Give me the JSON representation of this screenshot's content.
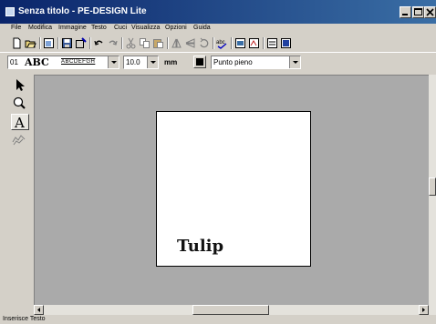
{
  "window": {
    "title": "Senza titolo - PE-DESIGN Lite"
  },
  "menubar": {
    "items": [
      "File",
      "Modifica",
      "Immagine",
      "Testo",
      "Cuci",
      "Visualizza",
      "Opzioni",
      "Guida"
    ]
  },
  "text_toolbar": {
    "font_number": "01",
    "font_sample": "ABC",
    "font_style": "ABCDEFGH",
    "size_value": "10.0",
    "size_unit": "mm",
    "sew_type": "Punto pieno",
    "thread_color": "#000000"
  },
  "canvas": {
    "text": "Tulip"
  },
  "status": {
    "text": "Inserisce Testo"
  },
  "colors": {
    "title_start": "#0a246a",
    "title_end": "#3a6ea5",
    "chrome": "#d4d0c8",
    "workspace": "#aaaaaa"
  }
}
